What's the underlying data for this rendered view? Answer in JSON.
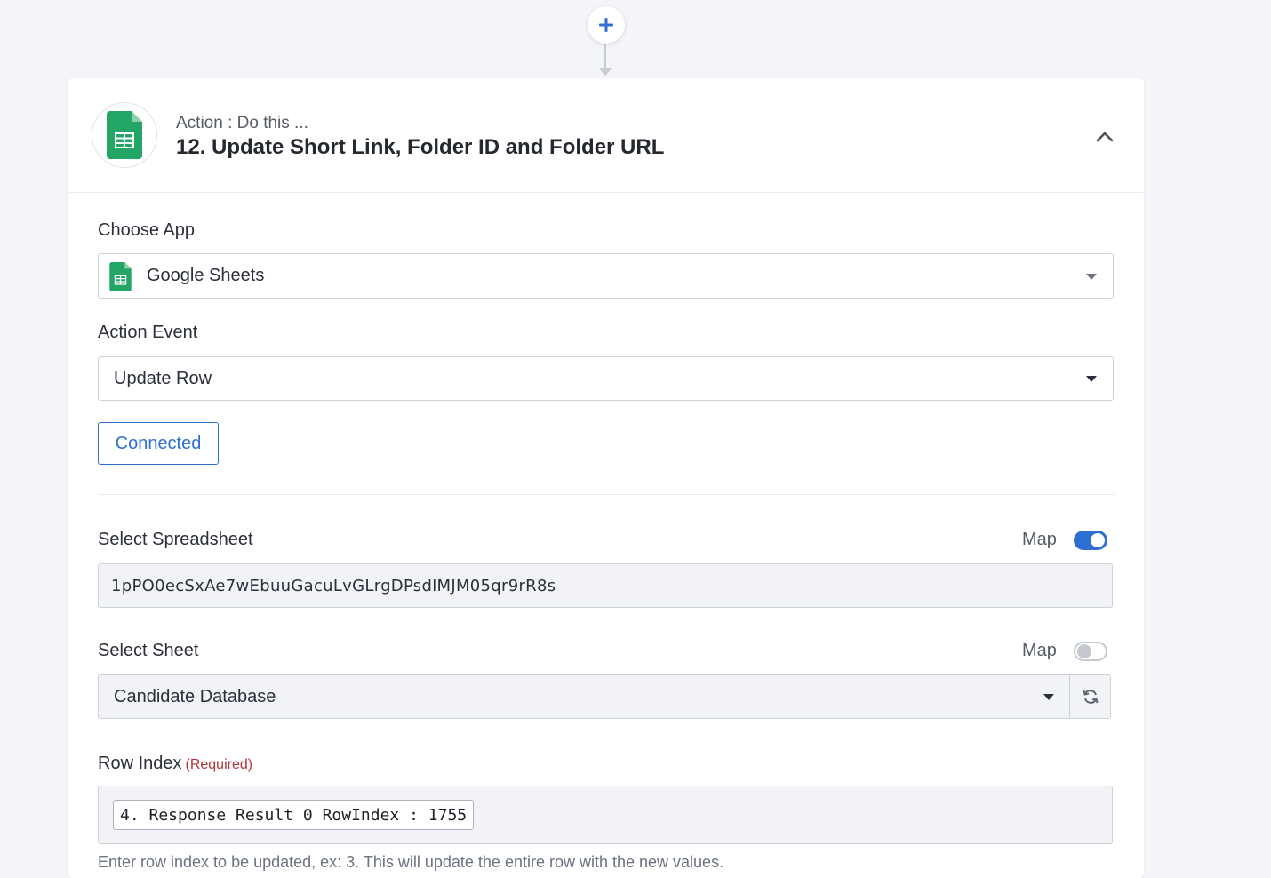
{
  "connector": {
    "add_icon": "plus-icon"
  },
  "step": {
    "subtitle": "Action : Do this ...",
    "title": "12. Update Short Link, Folder ID and Folder URL",
    "app_icon": "google-sheets-icon",
    "collapse_icon": "chevron-up-icon"
  },
  "choose_app": {
    "label": "Choose App",
    "value": "Google Sheets",
    "icon": "google-sheets-icon"
  },
  "action_event": {
    "label": "Action Event",
    "value": "Update Row"
  },
  "connection": {
    "button_label": "Connected"
  },
  "spreadsheet": {
    "label": "Select Spreadsheet",
    "map_label": "Map",
    "map_enabled": true,
    "value": "1pPO0ecSxAe7wEbuuGacuLvGLrgDPsdlMJM05qr9rR8s"
  },
  "sheet": {
    "label": "Select Sheet",
    "map_label": "Map",
    "map_enabled": false,
    "value": "Candidate Database",
    "refresh_icon": "refresh-icon"
  },
  "row_index": {
    "label": "Row Index",
    "required_label": "(Required)",
    "chip_value": "4. Response Result 0 RowIndex : 1755",
    "help": "Enter row index to be updated, ex: 3. This will update the entire row with the new values."
  },
  "colors": {
    "accent": "#2e6fd3",
    "sheets_green": "#23a566",
    "required_red": "#b3333b",
    "page_bg": "#f3f5f8"
  }
}
